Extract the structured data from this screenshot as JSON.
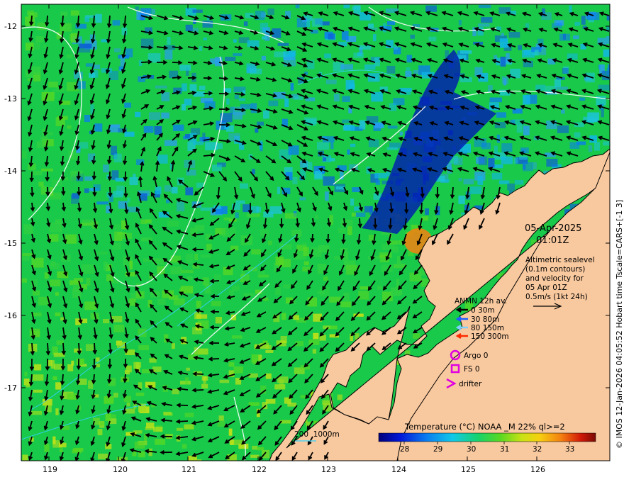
{
  "map": {
    "lat_ticks": [
      "-12",
      "-13",
      "-14",
      "-15",
      "-16",
      "-17"
    ],
    "lon_ticks": [
      "119",
      "120",
      "121",
      "122",
      "123",
      "124",
      "125",
      "126"
    ],
    "date": "05-Apr-2025",
    "time": "01:01Z",
    "alt_desc": [
      "Altimetric sealevel",
      "(0.1m contours)",
      "and velocity for",
      "05 Apr 01Z",
      "0.5m/s (1kt 24h)"
    ],
    "anmn_title": "ANMN 12h av.",
    "anmn_items": [
      {
        "label": "0 30m",
        "color": "#000000"
      },
      {
        "label": "30 80m",
        "color": "#1f5fff"
      },
      {
        "label": "80 150m",
        "color": "#7fd0ff"
      },
      {
        "label": "150 300m",
        "color": "#ff2a00"
      }
    ],
    "argo_label": "Argo 0",
    "fs_label": "FS 0",
    "drifter_label": "drifter",
    "colorbar_title": "Temperature (°C) NOAA _M 22% ql>=2",
    "colorbar_ticks": [
      "28",
      "29",
      "30",
      "31",
      "32",
      "33"
    ],
    "contour_legend": "200  1000m",
    "credit": "© IMOS 12-Jan-2026 04:05:52 Hobart time Tscale=CARS+[-1 3]",
    "colors": {
      "land": "#f8c89e",
      "sea_mid": "#19c94a",
      "marker": "#e000e0"
    }
  }
}
